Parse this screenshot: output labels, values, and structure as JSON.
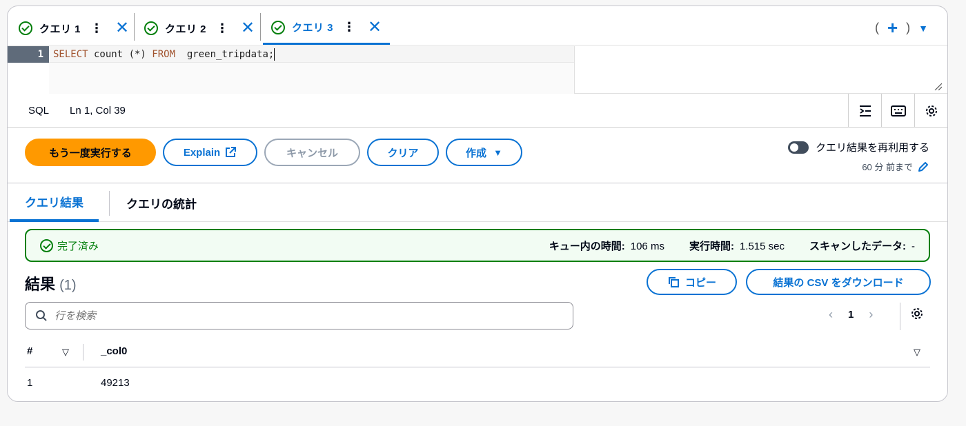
{
  "tabs": [
    {
      "label": "クエリ 1",
      "active": false
    },
    {
      "label": "クエリ 2",
      "active": false
    },
    {
      "label": "クエリ 3",
      "active": true
    }
  ],
  "tab_more": "⋮",
  "tab_close": "✕",
  "new_tab": {
    "open_paren": "(",
    "plus": "+",
    "close_paren": ")",
    "caret": "▼"
  },
  "editor": {
    "line_number": "1",
    "kw_select": "SELECT",
    "text_count": " count (*) ",
    "kw_from": "FROM",
    "text_table": "  green_tripdata;"
  },
  "statusbar": {
    "language": "SQL",
    "position": "Ln 1, Col 39"
  },
  "actions": {
    "run_again": "もう一度実行する",
    "explain": "Explain",
    "cancel": "キャンセル",
    "clear": "クリア",
    "create": "作成"
  },
  "reuse": {
    "label": "クエリ結果を再利用する",
    "age": "60 分 前まで"
  },
  "result_tabs": [
    "クエリ結果",
    "クエリの統計"
  ],
  "status": {
    "state": "完了済み",
    "queue_label": "キュー内の時間:",
    "queue_value": "106 ms",
    "run_label": "実行時間:",
    "run_value": "1.515 sec",
    "scan_label": "スキャンしたデータ:",
    "scan_value": "-"
  },
  "results": {
    "title": "結果",
    "count": "(1)",
    "copy": "コピー",
    "download": "結果の CSV をダウンロード",
    "search_placeholder": "行を検索",
    "page": "1",
    "columns": [
      "#",
      "_col0"
    ],
    "rows": [
      [
        "1",
        "49213"
      ]
    ]
  },
  "colors": {
    "accent": "#0972d3",
    "primary_button": "#ff9900",
    "success": "#037f0c"
  }
}
